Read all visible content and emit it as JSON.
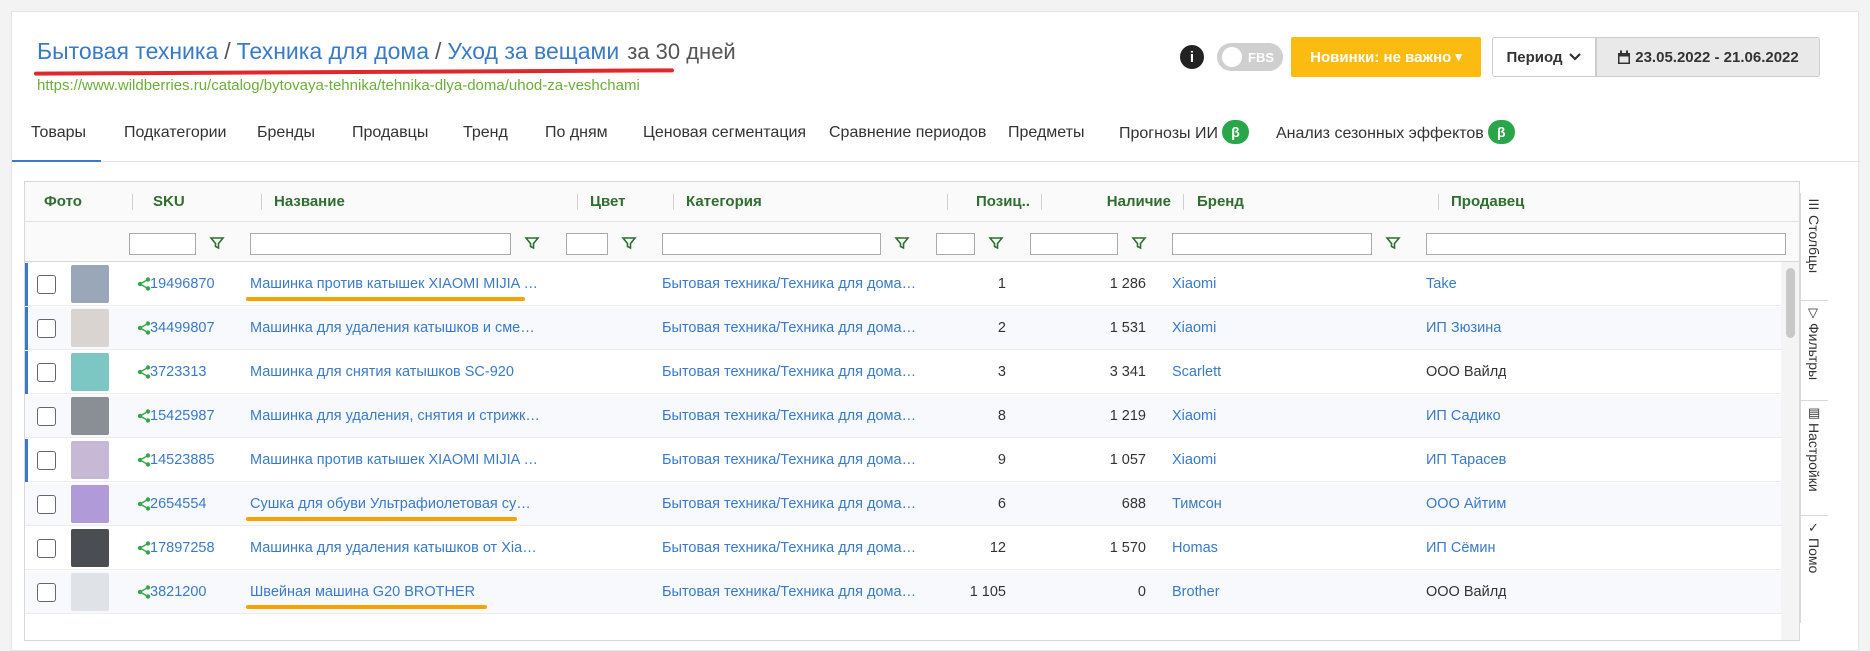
{
  "header": {
    "breadcrumb": [
      "Бытовая техника",
      "Техника для дома",
      "Уход за вещами"
    ],
    "breadcrumb_separator": "/",
    "period_suffix": "за 30 дней",
    "url": "https://www.wildberries.ru/catalog/bytovaya-tehnika/tehnika-dlya-doma/uhod-za-veshchami",
    "info_icon": "i",
    "fbs_label": "FBS",
    "novinki_label": "Новинки: не важно",
    "novinki_caret": "▾",
    "period_label": "Период",
    "period_caret": "⌄",
    "date_range": "23.05.2022 - 21.06.2022",
    "accent_color": "#fbbb10"
  },
  "tabs": [
    {
      "label": "Товары",
      "active": true
    },
    {
      "label": "Подкатегории"
    },
    {
      "label": "Бренды"
    },
    {
      "label": "Продавцы"
    },
    {
      "label": "Тренд"
    },
    {
      "label": "По дням"
    },
    {
      "label": "Ценовая сегментация"
    },
    {
      "label": "Сравнение периодов"
    },
    {
      "label": "Предметы"
    },
    {
      "label": "Прогнозы ИИ",
      "badge": "β"
    },
    {
      "label": "Анализ сезонных эффектов",
      "badge": "β"
    }
  ],
  "grid": {
    "columns": [
      "Фото",
      "SKU",
      "Название",
      "Цвет",
      "Категория",
      "Позиц...",
      "Наличие",
      "Бренд",
      "Продавец"
    ],
    "rows": [
      {
        "sku": "19496870",
        "name": "Машинка против катышек XIAOMI MIJIA RECHA...",
        "category": "Бытовая техника/Техника для дома/Уход ...",
        "position": "1",
        "stock": "1 286",
        "brand": "Xiaomi",
        "seller": "Take",
        "seller_link": true,
        "bar": true,
        "thumb": "#9aa7b8"
      },
      {
        "sku": "34499807",
        "name": "Машинка для удаления катышков и сменное ле...",
        "category": "Бытовая техника/Техника для дома/Уход ...",
        "position": "2",
        "stock": "1 531",
        "brand": "Xiaomi",
        "seller": "ИП Зюзина",
        "seller_link": true,
        "bar": true,
        "thumb": "#d9d4d0"
      },
      {
        "sku": "3723313",
        "name": "Машинка для снятия катышков SC-920",
        "category": "Бытовая техника/Техника для дома/Уход ...",
        "position": "3",
        "stock": "3 341",
        "brand": "Scarlett",
        "seller": "ООО Вайлд",
        "seller_link": false,
        "bar": true,
        "thumb": "#7cc6c4"
      },
      {
        "sku": "15425987",
        "name": "Машинка для удаления, снятия и стрижки каты...",
        "category": "Бытовая техника/Техника для дома/Уход ...",
        "position": "8",
        "stock": "1 219",
        "brand": "Xiaomi",
        "seller": "ИП Садико",
        "seller_link": true,
        "bar": false,
        "thumb": "#8a8f95"
      },
      {
        "sku": "14523885",
        "name": "Машинка против катышек XIAOMI MIJIA RECHA...",
        "category": "Бытовая техника/Техника для дома/Уход ...",
        "position": "9",
        "stock": "1 057",
        "brand": "Xiaomi",
        "seller": "ИП Тарасев",
        "seller_link": true,
        "bar": true,
        "thumb": "#c7b8d6"
      },
      {
        "sku": "2654554",
        "name": "Сушка для обуви Ультрафиолетовая сушилка дл...",
        "category": "Бытовая техника/Техника для дома/Уход ...",
        "position": "6",
        "stock": "688",
        "brand": "Тимсон",
        "seller": "ООО Айтим",
        "seller_link": true,
        "bar": false,
        "thumb": "#b09ad8"
      },
      {
        "sku": "17897258",
        "name": "Машинка для удаления катышков от Xiaomi",
        "category": "Бытовая техника/Техника для дома/Уход ...",
        "position": "12",
        "stock": "1 570",
        "brand": "Homas",
        "seller": "ИП Сёмин",
        "seller_link": true,
        "bar": false,
        "thumb": "#4a4d52"
      },
      {
        "sku": "3821200",
        "name": "Швейная машина G20 BROTHER",
        "category": "Бытовая техника/Техника для дома/Уход ...",
        "position": "1 105",
        "stock": "0",
        "brand": "Brother",
        "seller": "ООО Вайлд",
        "seller_link": false,
        "bar": false,
        "thumb": "#dfe3e8"
      }
    ]
  },
  "sidebar": [
    {
      "label": "Столбцы",
      "icon": "columns-icon",
      "glyph": "☰"
    },
    {
      "label": "Фильтры",
      "icon": "filter-icon",
      "glyph": "▽"
    },
    {
      "label": "Настройки",
      "icon": "settings-icon",
      "glyph": "▤"
    },
    {
      "label": "Помо",
      "icon": "help-icon",
      "glyph": "✓"
    }
  ]
}
